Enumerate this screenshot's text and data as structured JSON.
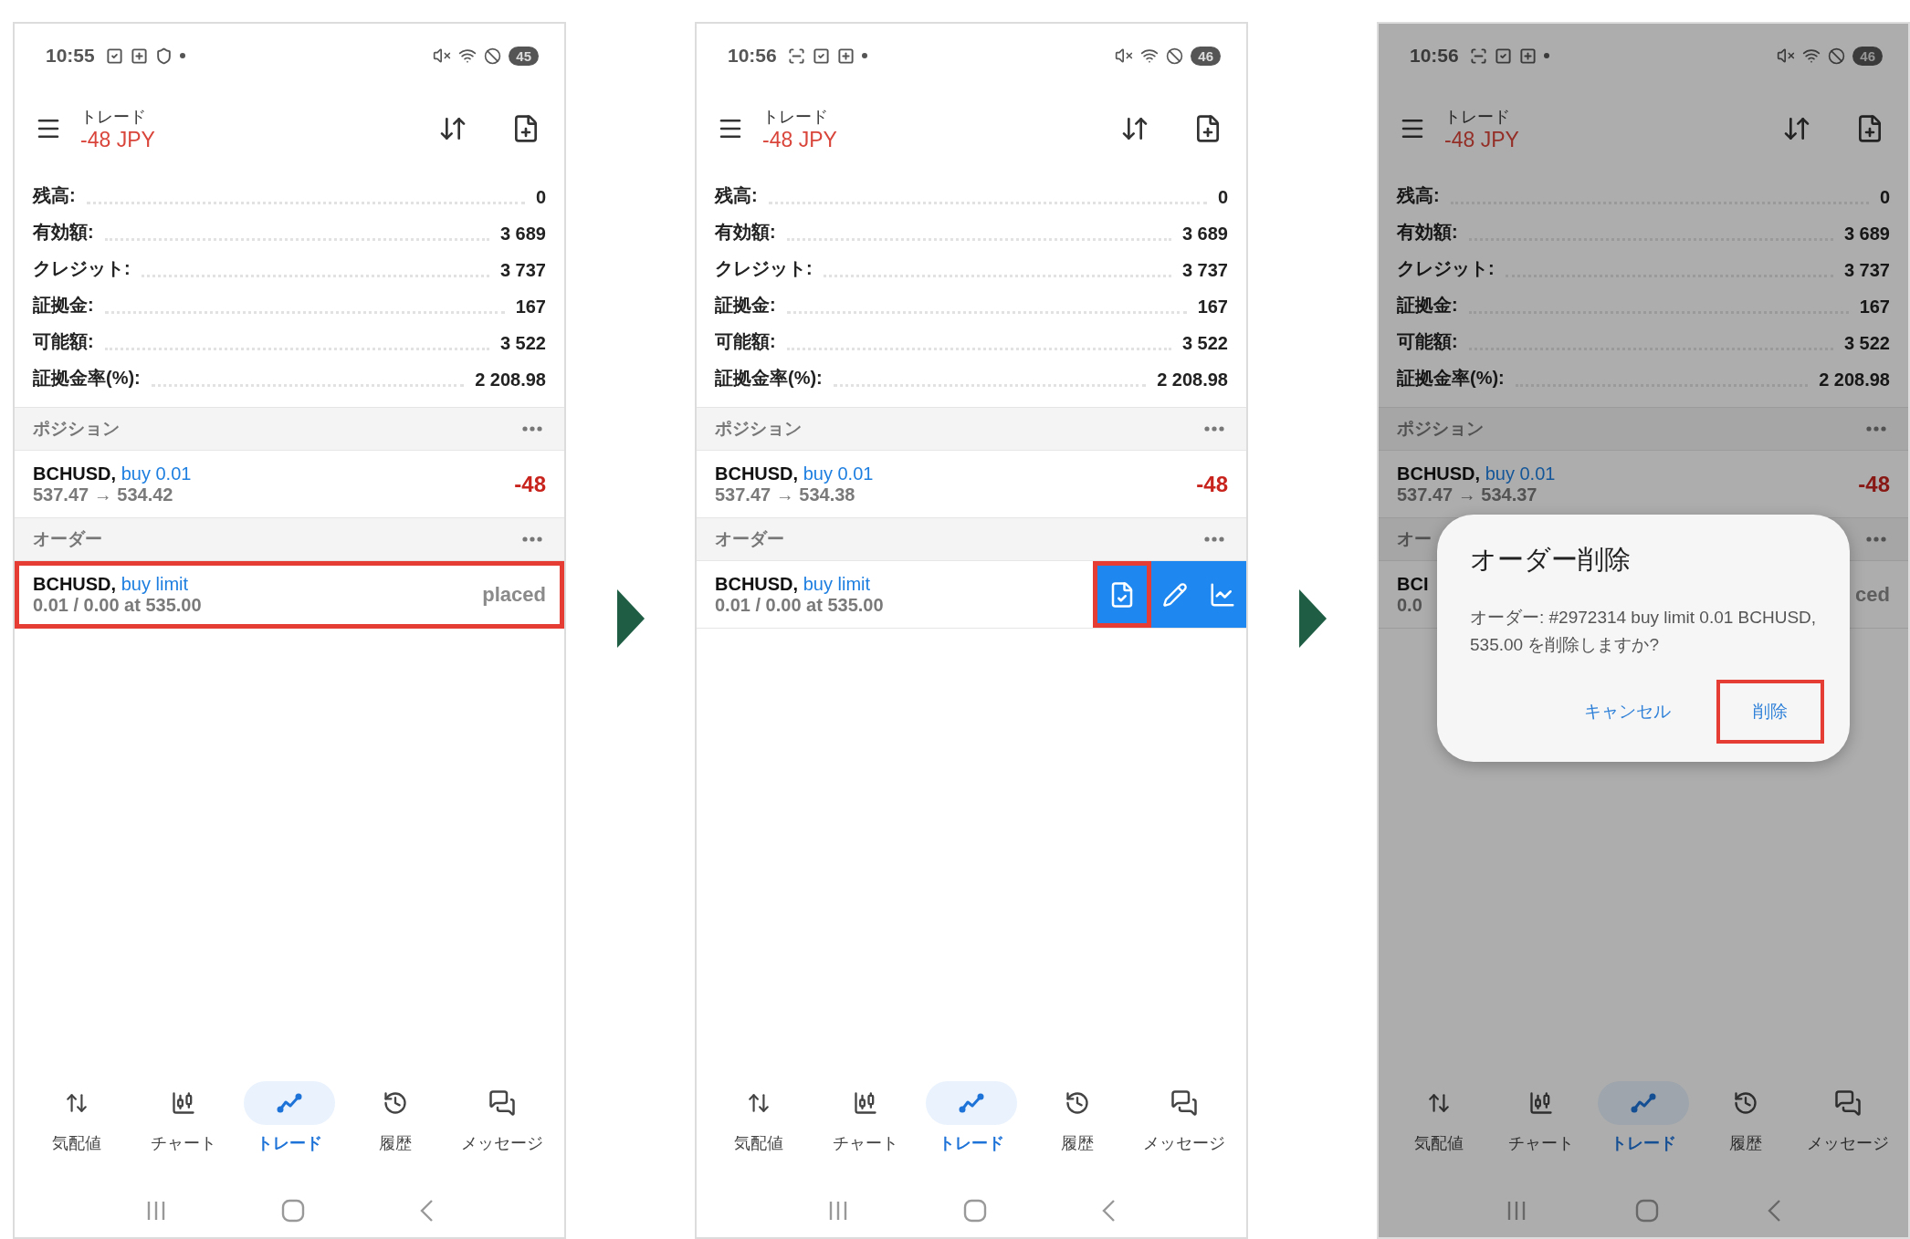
{
  "steps": [
    {
      "dimmed": false,
      "status_bar": {
        "time": "10:55",
        "icons": [
          {
            "kind": "check"
          },
          {
            "kind": "plus"
          },
          {
            "kind": "shield"
          }
        ],
        "battery": "45"
      },
      "header": {
        "title": "トレード",
        "profit": "-48 JPY"
      },
      "account": [
        {
          "label": "残高:",
          "value": "0"
        },
        {
          "label": "有効額:",
          "value": "3 689"
        },
        {
          "label": "クレジット:",
          "value": "3 737"
        },
        {
          "label": "証拠金:",
          "value": "167"
        },
        {
          "label": "可能額:",
          "value": "3 522"
        },
        {
          "label": "証拠金率(%):",
          "value": "2 208.98"
        }
      ],
      "positions": {
        "title": "ポジション",
        "rows": [
          {
            "symbol": "BCHUSD,",
            "side": "buy 0.01",
            "prices": "537.47 → 534.42",
            "profit": "-48"
          }
        ]
      },
      "orders": {
        "title": "オーダー",
        "rows": [
          {
            "symbol": "BCHUSD,",
            "side": "buy limit",
            "detail": "0.01 / 0.00 at 535.00",
            "state": "placed",
            "highlighted": true,
            "actions": []
          }
        ]
      },
      "nav": [
        {
          "kind": "quotes",
          "label": "気配値",
          "selected": false
        },
        {
          "kind": "chart",
          "label": "チャート",
          "selected": false
        },
        {
          "kind": "trade",
          "label": "トレード",
          "selected": true
        },
        {
          "kind": "history",
          "label": "履歴",
          "selected": false
        },
        {
          "kind": "messages",
          "label": "メッセージ",
          "selected": false
        }
      ]
    },
    {
      "dimmed": false,
      "status_bar": {
        "time": "10:56",
        "icons": [
          {
            "kind": "screenshot"
          },
          {
            "kind": "check"
          },
          {
            "kind": "plus"
          }
        ],
        "battery": "46"
      },
      "header": {
        "title": "トレード",
        "profit": "-48 JPY"
      },
      "account": [
        {
          "label": "残高:",
          "value": "0"
        },
        {
          "label": "有効額:",
          "value": "3 689"
        },
        {
          "label": "クレジット:",
          "value": "3 737"
        },
        {
          "label": "証拠金:",
          "value": "167"
        },
        {
          "label": "可能額:",
          "value": "3 522"
        },
        {
          "label": "証拠金率(%):",
          "value": "2 208.98"
        }
      ],
      "positions": {
        "title": "ポジション",
        "rows": [
          {
            "symbol": "BCHUSD,",
            "side": "buy 0.01",
            "prices": "537.47 → 534.38",
            "profit": "-48"
          }
        ]
      },
      "orders": {
        "title": "オーダー",
        "rows": [
          {
            "symbol": "BCHUSD,",
            "side": "buy limit",
            "detail": "0.01 / 0.00 at 535.00",
            "highlighted": false,
            "actions": [
              {
                "kind": "confirm",
                "highlighted": true
              },
              {
                "kind": "edit",
                "highlighted": false
              },
              {
                "kind": "chart",
                "highlighted": false
              }
            ]
          }
        ]
      },
      "nav": [
        {
          "kind": "quotes",
          "label": "気配値",
          "selected": false
        },
        {
          "kind": "chart",
          "label": "チャート",
          "selected": false
        },
        {
          "kind": "trade",
          "label": "トレード",
          "selected": true
        },
        {
          "kind": "history",
          "label": "履歴",
          "selected": false
        },
        {
          "kind": "messages",
          "label": "メッセージ",
          "selected": false
        }
      ]
    },
    {
      "dimmed": true,
      "status_bar": {
        "time": "10:56",
        "icons": [
          {
            "kind": "screenshot"
          },
          {
            "kind": "check"
          },
          {
            "kind": "plus"
          }
        ],
        "battery": "46"
      },
      "header": {
        "title": "トレード",
        "profit": "-48 JPY"
      },
      "account": [
        {
          "label": "残高:",
          "value": "0"
        },
        {
          "label": "有効額:",
          "value": "3 689"
        },
        {
          "label": "クレジット:",
          "value": "3 737"
        },
        {
          "label": "証拠金:",
          "value": "167"
        },
        {
          "label": "可能額:",
          "value": "3 522"
        },
        {
          "label": "証拠金率(%):",
          "value": "2 208.98"
        }
      ],
      "positions": {
        "title": "ポジション",
        "rows": [
          {
            "symbol": "BCHUSD,",
            "side": "buy 0.01",
            "prices": "537.47 → 534.37",
            "profit": "-48"
          }
        ]
      },
      "orders": {
        "title": "オー",
        "rows": [
          {
            "symbol": "BCI",
            "detail": "0.0",
            "state": "ced",
            "highlighted": false,
            "actions": []
          }
        ]
      },
      "nav": [
        {
          "kind": "quotes",
          "label": "気配値",
          "selected": false
        },
        {
          "kind": "chart",
          "label": "チャート",
          "selected": false
        },
        {
          "kind": "trade",
          "label": "トレード",
          "selected": true
        },
        {
          "kind": "history",
          "label": "履歴",
          "selected": false
        },
        {
          "kind": "messages",
          "label": "メッセージ",
          "selected": false
        }
      ],
      "dialog": {
        "title": "オーダー削除",
        "message": "オーダー: #2972314 buy limit 0.01 BCHUSD, 535.00 を削除しますか?",
        "buttons": [
          {
            "label": "キャンセル",
            "highlighted": false
          },
          {
            "label": "削除",
            "highlighted": true
          }
        ]
      }
    }
  ]
}
